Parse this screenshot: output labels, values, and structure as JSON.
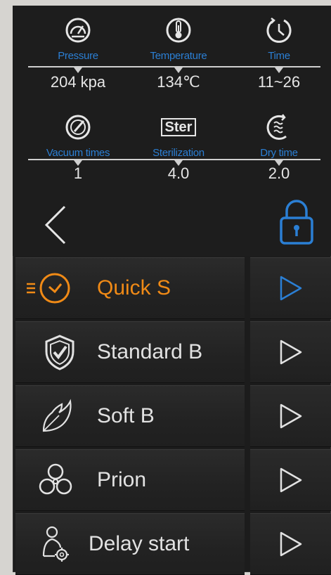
{
  "params": {
    "pressure": {
      "label": "Pressure",
      "value": "204 kpa",
      "icon": "gauge-icon"
    },
    "temperature": {
      "label": "Temperature",
      "value": "134℃",
      "icon": "thermometer-icon"
    },
    "time": {
      "label": "Time",
      "value": "11~26",
      "icon": "clock-icon"
    },
    "vacuum": {
      "label": "Vacuum times",
      "value": "1",
      "icon": "vacuum-gauge-icon"
    },
    "sterilization": {
      "label": "Sterilization",
      "value": "4.0",
      "icon_text": "Ster"
    },
    "dry": {
      "label": "Dry time",
      "value": "2.0",
      "icon": "dry-wave-icon"
    }
  },
  "nav": {
    "back_icon": "back-chevron-icon",
    "lock_icon": "lock-icon"
  },
  "programs": [
    {
      "label": "Quick  S",
      "icon": "quick-clock-icon",
      "active": true
    },
    {
      "label": "Standard B",
      "icon": "shield-check-icon",
      "active": false
    },
    {
      "label": "Soft B",
      "icon": "feather-icon",
      "active": false
    },
    {
      "label": "Prion",
      "icon": "biohazard-icon",
      "active": false
    },
    {
      "label": "Delay start",
      "icon": "person-gear-icon",
      "active": false
    }
  ],
  "colors": {
    "accent_blue": "#2b7fd4",
    "accent_orange": "#f08a16",
    "text": "#e2e2e2",
    "panel": "#1d1d1d"
  }
}
